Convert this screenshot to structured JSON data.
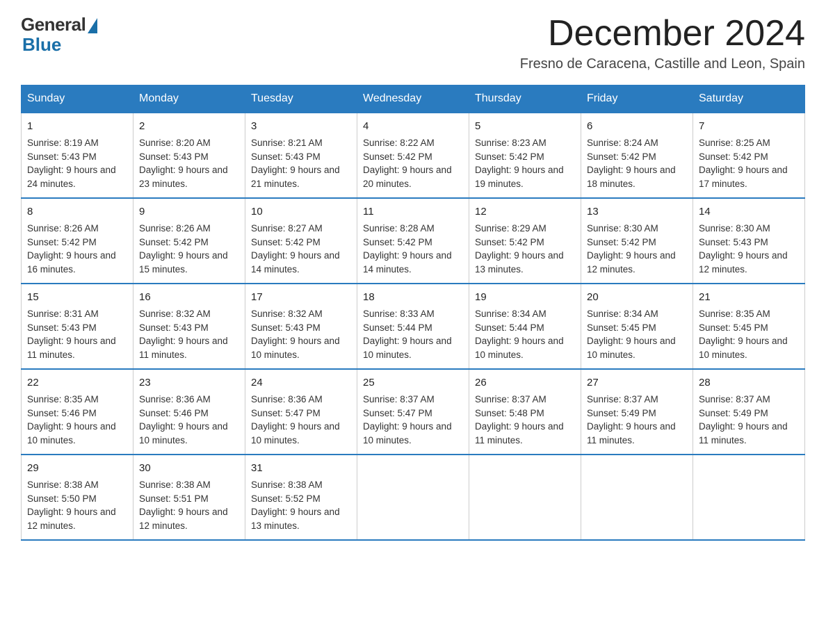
{
  "logo": {
    "general": "General",
    "blue": "Blue"
  },
  "title": "December 2024",
  "location": "Fresno de Caracena, Castille and Leon, Spain",
  "days_of_week": [
    "Sunday",
    "Monday",
    "Tuesday",
    "Wednesday",
    "Thursday",
    "Friday",
    "Saturday"
  ],
  "weeks": [
    [
      {
        "day": "1",
        "sunrise": "8:19 AM",
        "sunset": "5:43 PM",
        "daylight": "9 hours and 24 minutes."
      },
      {
        "day": "2",
        "sunrise": "8:20 AM",
        "sunset": "5:43 PM",
        "daylight": "9 hours and 23 minutes."
      },
      {
        "day": "3",
        "sunrise": "8:21 AM",
        "sunset": "5:43 PM",
        "daylight": "9 hours and 21 minutes."
      },
      {
        "day": "4",
        "sunrise": "8:22 AM",
        "sunset": "5:42 PM",
        "daylight": "9 hours and 20 minutes."
      },
      {
        "day": "5",
        "sunrise": "8:23 AM",
        "sunset": "5:42 PM",
        "daylight": "9 hours and 19 minutes."
      },
      {
        "day": "6",
        "sunrise": "8:24 AM",
        "sunset": "5:42 PM",
        "daylight": "9 hours and 18 minutes."
      },
      {
        "day": "7",
        "sunrise": "8:25 AM",
        "sunset": "5:42 PM",
        "daylight": "9 hours and 17 minutes."
      }
    ],
    [
      {
        "day": "8",
        "sunrise": "8:26 AM",
        "sunset": "5:42 PM",
        "daylight": "9 hours and 16 minutes."
      },
      {
        "day": "9",
        "sunrise": "8:26 AM",
        "sunset": "5:42 PM",
        "daylight": "9 hours and 15 minutes."
      },
      {
        "day": "10",
        "sunrise": "8:27 AM",
        "sunset": "5:42 PM",
        "daylight": "9 hours and 14 minutes."
      },
      {
        "day": "11",
        "sunrise": "8:28 AM",
        "sunset": "5:42 PM",
        "daylight": "9 hours and 14 minutes."
      },
      {
        "day": "12",
        "sunrise": "8:29 AM",
        "sunset": "5:42 PM",
        "daylight": "9 hours and 13 minutes."
      },
      {
        "day": "13",
        "sunrise": "8:30 AM",
        "sunset": "5:42 PM",
        "daylight": "9 hours and 12 minutes."
      },
      {
        "day": "14",
        "sunrise": "8:30 AM",
        "sunset": "5:43 PM",
        "daylight": "9 hours and 12 minutes."
      }
    ],
    [
      {
        "day": "15",
        "sunrise": "8:31 AM",
        "sunset": "5:43 PM",
        "daylight": "9 hours and 11 minutes."
      },
      {
        "day": "16",
        "sunrise": "8:32 AM",
        "sunset": "5:43 PM",
        "daylight": "9 hours and 11 minutes."
      },
      {
        "day": "17",
        "sunrise": "8:32 AM",
        "sunset": "5:43 PM",
        "daylight": "9 hours and 10 minutes."
      },
      {
        "day": "18",
        "sunrise": "8:33 AM",
        "sunset": "5:44 PM",
        "daylight": "9 hours and 10 minutes."
      },
      {
        "day": "19",
        "sunrise": "8:34 AM",
        "sunset": "5:44 PM",
        "daylight": "9 hours and 10 minutes."
      },
      {
        "day": "20",
        "sunrise": "8:34 AM",
        "sunset": "5:45 PM",
        "daylight": "9 hours and 10 minutes."
      },
      {
        "day": "21",
        "sunrise": "8:35 AM",
        "sunset": "5:45 PM",
        "daylight": "9 hours and 10 minutes."
      }
    ],
    [
      {
        "day": "22",
        "sunrise": "8:35 AM",
        "sunset": "5:46 PM",
        "daylight": "9 hours and 10 minutes."
      },
      {
        "day": "23",
        "sunrise": "8:36 AM",
        "sunset": "5:46 PM",
        "daylight": "9 hours and 10 minutes."
      },
      {
        "day": "24",
        "sunrise": "8:36 AM",
        "sunset": "5:47 PM",
        "daylight": "9 hours and 10 minutes."
      },
      {
        "day": "25",
        "sunrise": "8:37 AM",
        "sunset": "5:47 PM",
        "daylight": "9 hours and 10 minutes."
      },
      {
        "day": "26",
        "sunrise": "8:37 AM",
        "sunset": "5:48 PM",
        "daylight": "9 hours and 11 minutes."
      },
      {
        "day": "27",
        "sunrise": "8:37 AM",
        "sunset": "5:49 PM",
        "daylight": "9 hours and 11 minutes."
      },
      {
        "day": "28",
        "sunrise": "8:37 AM",
        "sunset": "5:49 PM",
        "daylight": "9 hours and 11 minutes."
      }
    ],
    [
      {
        "day": "29",
        "sunrise": "8:38 AM",
        "sunset": "5:50 PM",
        "daylight": "9 hours and 12 minutes."
      },
      {
        "day": "30",
        "sunrise": "8:38 AM",
        "sunset": "5:51 PM",
        "daylight": "9 hours and 12 minutes."
      },
      {
        "day": "31",
        "sunrise": "8:38 AM",
        "sunset": "5:52 PM",
        "daylight": "9 hours and 13 minutes."
      },
      null,
      null,
      null,
      null
    ]
  ]
}
